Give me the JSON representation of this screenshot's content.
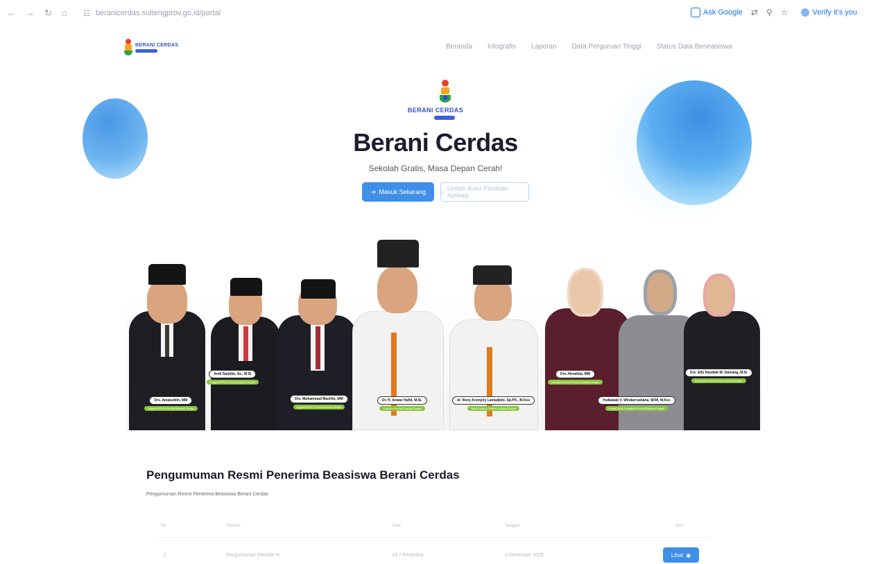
{
  "browser": {
    "url": "beranicerdas.sultengprov.go.id/portal",
    "ask_google": "Ask Google",
    "verify_label": "Verify it's you"
  },
  "nav": {
    "brand": "BERANI CERDAS",
    "items": [
      {
        "label": "Beranda"
      },
      {
        "label": "Infografis"
      },
      {
        "label": "Laporan"
      },
      {
        "label": "Data Perguruan Tinggi"
      },
      {
        "label": "Status Data Beneasiswa"
      }
    ]
  },
  "hero": {
    "brand": "BERANI CERDAS",
    "title": "Berani Cerdas",
    "subtitle": "Sekolah Gratis, Masa Depan Cerah!",
    "primary_button": "Masuk Sekarang",
    "secondary_button": "Unduh Buku Panduan Aplikasi"
  },
  "banner": {
    "people": [
      {
        "name": "Drs. Amaluddin, MM",
        "role": "Anggota DPR RI Provinsi Sulawesi Tengah"
      },
      {
        "name": "Andi Sarjidin, Se., M.Si",
        "role": "Anggota DPRD Provinsi Sulawesi Tengah"
      },
      {
        "name": "Drs. Muhammad Machfiz, MM",
        "role": "Anggota DPRD Provinsi Sulawesi Tengah"
      },
      {
        "name": "Dr. H. Anwar Hafid, M.Si.",
        "role": "Gubernur Provinsi Sulawesi Tengah"
      },
      {
        "name": "dr. Reny Arsinjcty Lamadjido, Sp.PK., M.Kes",
        "role": "Wakil Gubernur Provinsi Sulawesi Tengah"
      },
      {
        "name": "Drs. Novalina, MM",
        "role": "Sekretaris Daerah Provinsi Sulawesi Tengah"
      },
      {
        "name": "Yudiawati V. Windarrusliana, SKM, M.Kes",
        "role": "Kepala Dinas Pendidikan Provinsi Sulawesi Tengah"
      },
      {
        "name": "Drs. Elfy Hasdiah M. Dareang, M.Si",
        "role": "Kepala Biro Kesra Provinsi Sulawesi Tengah"
      }
    ]
  },
  "announcement": {
    "title": "Pengumuman Resmi Penerima Beasiswa Berani Cerdas",
    "subtitle": "Pengumuman Resmi Penerima Beasiswa Berani Cerdas",
    "columns": [
      "No",
      "Periode",
      "Total",
      "Tanggal",
      "Aksi"
    ],
    "rows": [
      {
        "no": "1",
        "periode": "Pengumuman Periode III",
        "total": "24.7 Penerima",
        "tanggal": "3 Desember 2025",
        "action": "Lihat"
      }
    ]
  },
  "colors": {
    "primary": "#3f8fe8",
    "green_label": "#8cc63f",
    "title": "#1c1c2e"
  }
}
